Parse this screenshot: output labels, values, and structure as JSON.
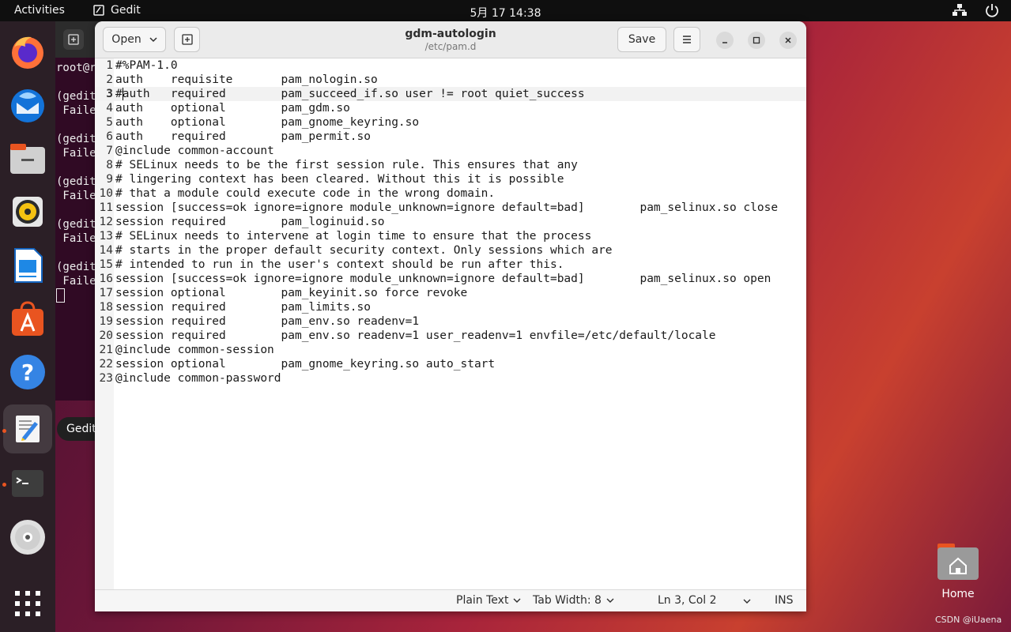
{
  "topbar": {
    "activities": "Activities",
    "app_name": "Gedit",
    "clock": "5月 17  14:38"
  },
  "dock": {
    "tooltip": "Gedit",
    "apps": [
      "firefox",
      "thunderbird",
      "files",
      "rhythmbox",
      "libreoffice-writer",
      "app-center",
      "help",
      "gedit",
      "terminal",
      "dvd",
      "show-apps"
    ]
  },
  "terminal": {
    "lines": [
      "root@r",
      "",
      "(gedit",
      " Faile",
      "",
      "(gedit",
      " Faile",
      "",
      "(gedit",
      " Faile",
      "",
      "(gedit",
      " Faile",
      "",
      "(gedit",
      " Faile"
    ]
  },
  "gedit": {
    "open_label": "Open",
    "save_label": "Save",
    "title": "gdm-autologin",
    "subtitle": "/etc/pam.d",
    "current_line": 3,
    "lines": [
      "#%PAM-1.0",
      "auth    requisite       pam_nologin.so",
      "#auth   required        pam_succeed_if.so user != root quiet_success",
      "auth    optional        pam_gdm.so",
      "auth    optional        pam_gnome_keyring.so",
      "auth    required        pam_permit.so",
      "@include common-account",
      "# SELinux needs to be the first session rule. This ensures that any",
      "# lingering context has been cleared. Without this it is possible",
      "# that a module could execute code in the wrong domain.",
      "session [success=ok ignore=ignore module_unknown=ignore default=bad]        pam_selinux.so close",
      "session required        pam_loginuid.so",
      "# SELinux needs to intervene at login time to ensure that the process",
      "# starts in the proper default security context. Only sessions which are",
      "# intended to run in the user's context should be run after this.",
      "session [success=ok ignore=ignore module_unknown=ignore default=bad]        pam_selinux.so open",
      "session optional        pam_keyinit.so force revoke",
      "session required        pam_limits.so",
      "session required        pam_env.so readenv=1",
      "session required        pam_env.so readenv=1 user_readenv=1 envfile=/etc/default/locale",
      "@include common-session",
      "session optional        pam_gnome_keyring.so auto_start",
      "@include common-password"
    ],
    "status": {
      "language": "Plain Text",
      "tab_width": "Tab Width: 8",
      "position": "Ln 3, Col 2",
      "mode": "INS"
    }
  },
  "desktop": {
    "home_label": "Home",
    "watermark": "CSDN @iUaena"
  },
  "colors": {
    "accent": "#e95420",
    "topbar": "#0f0f0f",
    "dock": "#2b1f26",
    "terminal_bg": "#300a24"
  }
}
